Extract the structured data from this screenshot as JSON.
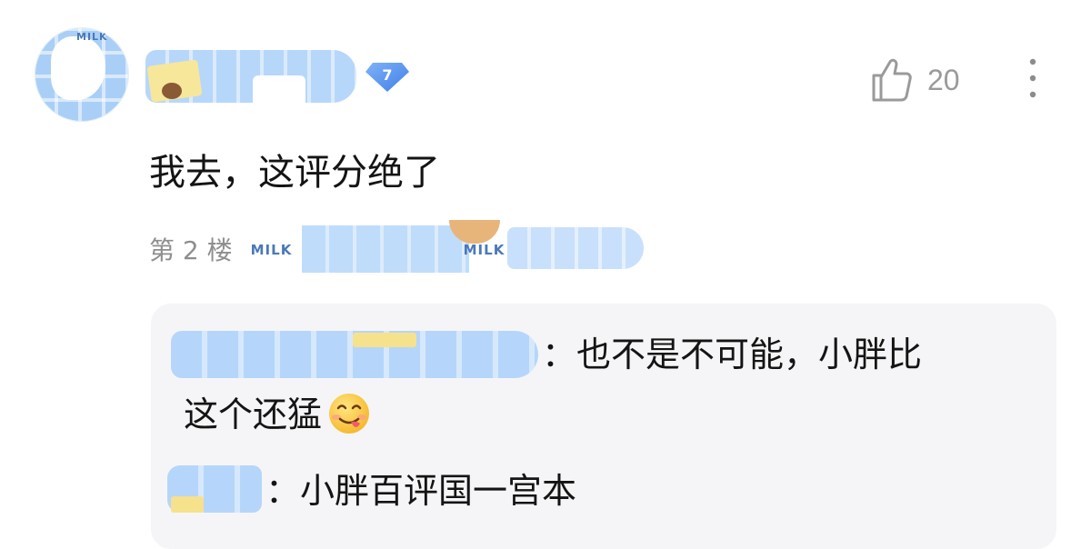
{
  "post": {
    "avatar_tag": "MILK",
    "level": "7",
    "likes": "20",
    "text": "我去，这评分绝了",
    "floor": "第 2 楼",
    "decor_tags": [
      "MILK",
      "MILK"
    ],
    "icons": [
      "like-icon",
      "more-icon"
    ]
  },
  "replies": [
    {
      "separator": "：",
      "text_line1": "也不是不可能，小胖比",
      "text_line2": "这个还猛",
      "emoji": "yum-face"
    },
    {
      "separator": "：",
      "text_line1": "小胖百评国一宫本"
    }
  ]
}
